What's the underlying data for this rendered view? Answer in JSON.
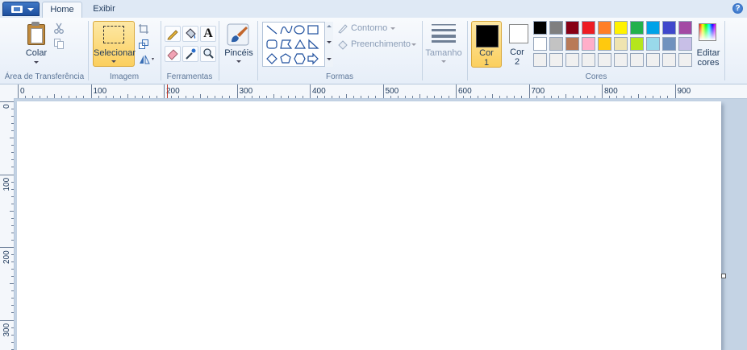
{
  "tabs": {
    "home": "Home",
    "view": "Exibir"
  },
  "help": "?",
  "clipboard": {
    "paste": "Colar",
    "group": "Área de Transferência"
  },
  "image": {
    "select": "Selecionar",
    "group": "Imagem"
  },
  "tools": {
    "text_tool": "A",
    "group": "Ferramentas"
  },
  "brushes": {
    "label": "Pincéis"
  },
  "shapes": {
    "outline": "Contorno",
    "fill": "Preenchimento",
    "group": "Formas"
  },
  "size": {
    "label": "Tamanho"
  },
  "colors": {
    "color1_line1": "Cor",
    "color1_line2": "1",
    "color2_line1": "Cor",
    "color2_line2": "2",
    "edit_line1": "Editar",
    "edit_line2": "cores",
    "group": "Cores",
    "color1_value": "#000000",
    "color2_value": "#ffffff",
    "palette_row1": [
      "#000000",
      "#7f7f7f",
      "#880015",
      "#ed1c24",
      "#ff7f27",
      "#fff200",
      "#22b14c",
      "#00a2e8",
      "#3f48cc",
      "#a349a4"
    ],
    "palette_row2": [
      "#ffffff",
      "#c3c3c3",
      "#b97a57",
      "#ffaec9",
      "#ffc90e",
      "#efe4b0",
      "#b5e61d",
      "#99d9ea",
      "#7092be",
      "#c8bfe7"
    ],
    "palette_row3": [
      "#f0f0f0",
      "#f0f0f0",
      "#f0f0f0",
      "#f0f0f0",
      "#f0f0f0",
      "#f0f0f0",
      "#f0f0f0",
      "#f0f0f0",
      "#f0f0f0",
      "#f0f0f0"
    ]
  },
  "ruler": {
    "h_labels": [
      "0",
      "100",
      "200",
      "300",
      "400",
      "500",
      "600",
      "700",
      "800",
      "900"
    ],
    "v_labels": [
      "0",
      "100",
      "200",
      "300"
    ]
  }
}
